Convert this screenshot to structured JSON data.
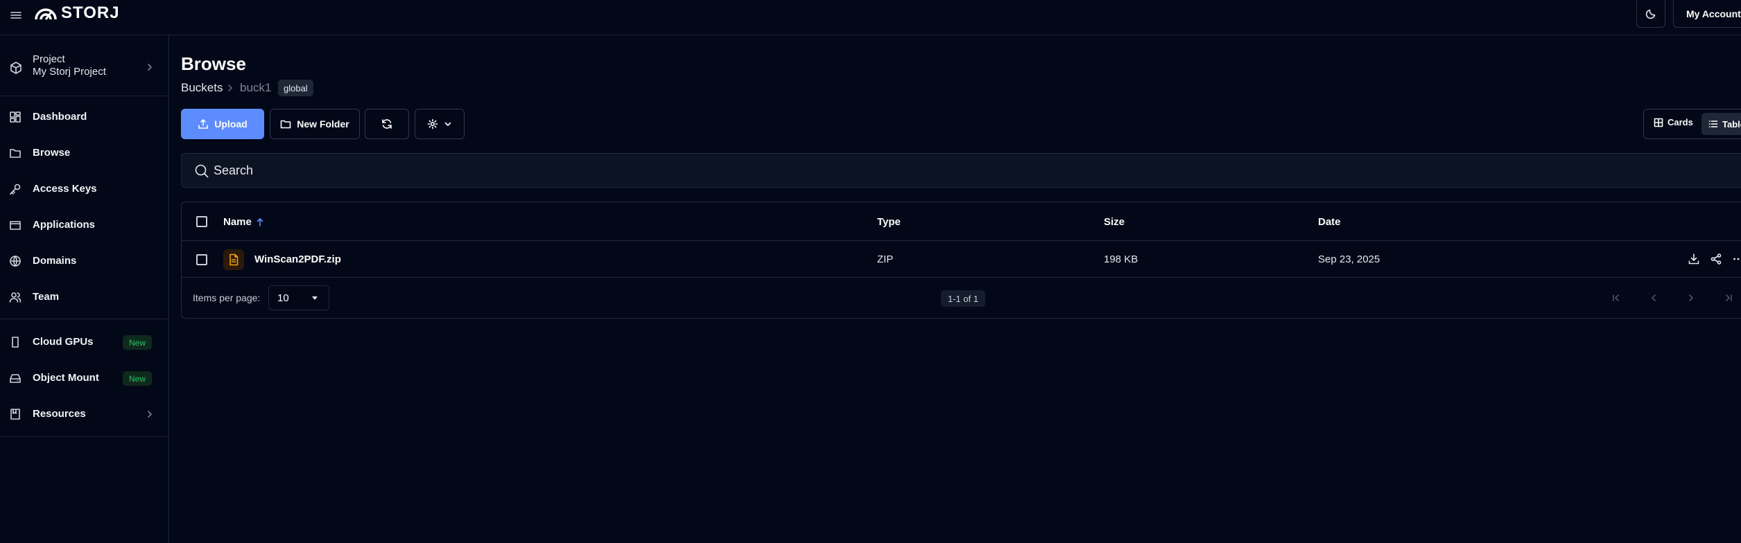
{
  "app": {
    "logo_text": "STORJ",
    "account_label": "My Account"
  },
  "sidebar": {
    "project_label": "Project",
    "project_name": "My Storj Project",
    "items": [
      {
        "label": "Dashboard",
        "icon": "dashboard-icon"
      },
      {
        "label": "Browse",
        "icon": "folder-icon"
      },
      {
        "label": "Access Keys",
        "icon": "key-icon"
      },
      {
        "label": "Applications",
        "icon": "applications-icon"
      },
      {
        "label": "Domains",
        "icon": "globe-icon"
      },
      {
        "label": "Team",
        "icon": "team-icon"
      }
    ],
    "extra_items": [
      {
        "label": "Cloud GPUs",
        "badge": "New",
        "icon": "gpu-icon"
      },
      {
        "label": "Object Mount",
        "badge": "New",
        "icon": "drive-icon"
      },
      {
        "label": "Resources",
        "icon": "book-icon"
      }
    ]
  },
  "page": {
    "title": "Browse",
    "breadcrumb": {
      "root": "Buckets",
      "bucket": "buck1",
      "badge": "global"
    }
  },
  "toolbar": {
    "upload_label": "Upload",
    "new_folder_label": "New Folder",
    "view_cards_label": "Cards",
    "view_table_label": "Table",
    "active_view": "Table"
  },
  "search": {
    "placeholder": "Search",
    "value": ""
  },
  "table": {
    "columns": [
      "Name",
      "Type",
      "Size",
      "Date"
    ],
    "sort": {
      "column": "Name",
      "direction": "asc"
    },
    "rows": [
      {
        "name": "WinScan2PDF.zip",
        "type": "ZIP",
        "size": "198 KB",
        "date": "Sep 23, 2025",
        "icon": "file-icon"
      }
    ],
    "footer": {
      "items_per_page_label": "Items per page:",
      "items_per_page": "10",
      "range": "1-1 of 1"
    }
  },
  "colors": {
    "background": "#020817",
    "accent": "#5c8cff",
    "new_badge": "#22c55e",
    "file_icon": "#f59e0b"
  }
}
